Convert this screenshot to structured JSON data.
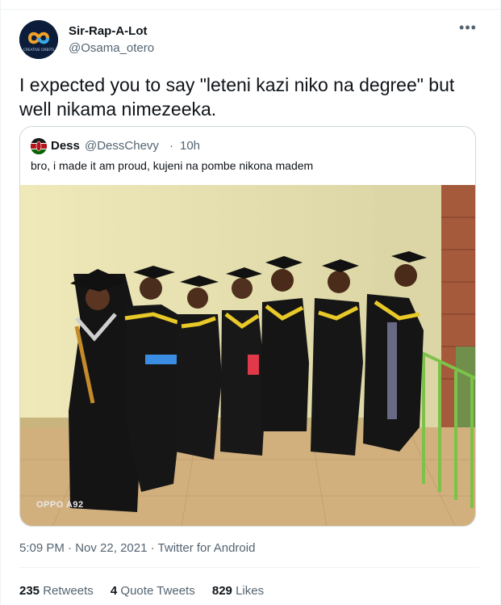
{
  "author": {
    "name": "Sir-Rap-A-Lot",
    "handle": "@Osama_otero",
    "avatar_icon": "infinity-logo-icon",
    "avatar_caption": "CREATIVE ORBITS"
  },
  "more_icon": "more-horizontal-icon",
  "tweet_text": "I expected you to say \"leteni kazi niko na degree\" but\nwell nikama nimezeeka.",
  "quote": {
    "name": "Dess",
    "handle": "@DessChevy",
    "separator": "·",
    "time": "10h",
    "text": "bro, i made it am proud, kujeni na pombe nikona madem",
    "avatar_icon": "kenya-flag-avatar-icon",
    "photo_watermark": "OPPO A92"
  },
  "meta": {
    "time": "5:09 PM",
    "dot": "·",
    "date": "Nov 22, 2021",
    "source": "Twitter for Android"
  },
  "stats": {
    "retweets_count": "235",
    "retweets_label": "Retweets",
    "quotes_count": "4",
    "quotes_label": "Quote Tweets",
    "likes_count": "829",
    "likes_label": "Likes"
  },
  "colors": {
    "text_primary": "#0f1419",
    "text_secondary": "#536471",
    "border": "#cfd9de",
    "wall": "#e9e4b0",
    "gown": "#151515",
    "sash": "#e8c928"
  }
}
